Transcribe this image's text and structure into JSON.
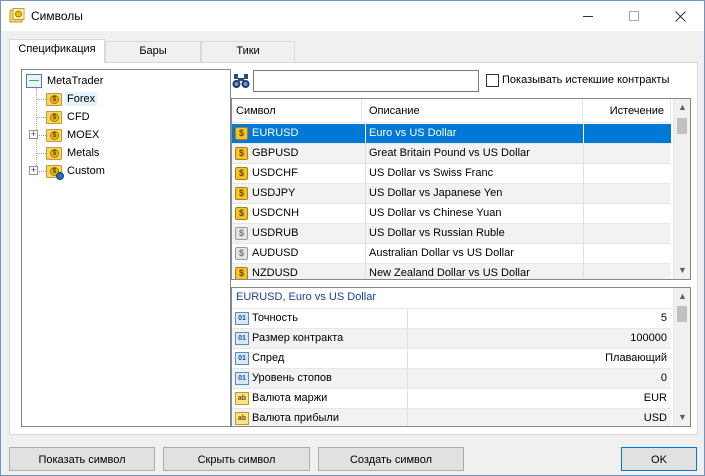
{
  "window": {
    "title": "Символы",
    "colors": {
      "accent": "#0078d7",
      "selected_tree": "#e5f3ff",
      "props_title": "#1a3fa0"
    }
  },
  "tabs": [
    {
      "label": "Спецификация",
      "active": true
    },
    {
      "label": "Бары",
      "active": false
    },
    {
      "label": "Тики",
      "active": false
    }
  ],
  "tree": {
    "root": "MetaTrader",
    "items": [
      {
        "label": "Forex",
        "selected": true,
        "expandable": false,
        "icon": "currency-folder-icon"
      },
      {
        "label": "CFD",
        "selected": false,
        "expandable": false,
        "icon": "currency-folder-icon"
      },
      {
        "label": "MOEX",
        "selected": false,
        "expandable": true,
        "icon": "currency-folder-icon"
      },
      {
        "label": "Metals",
        "selected": false,
        "expandable": false,
        "icon": "currency-folder-icon"
      },
      {
        "label": "Custom",
        "selected": false,
        "expandable": true,
        "icon": "custom-folder-icon"
      }
    ]
  },
  "search": {
    "value": "",
    "show_expired_label": "Показывать истекшие контракты",
    "show_expired_checked": false
  },
  "symbols": {
    "columns": [
      "Символ",
      "Описание",
      "Истечение"
    ],
    "rows": [
      {
        "symbol": "EURUSD",
        "description": "Euro vs US Dollar",
        "expiry": "",
        "enabled": true,
        "selected": true
      },
      {
        "symbol": "GBPUSD",
        "description": "Great Britain Pound vs US Dollar",
        "expiry": "",
        "enabled": true,
        "selected": false
      },
      {
        "symbol": "USDCHF",
        "description": "US Dollar vs Swiss Franc",
        "expiry": "",
        "enabled": true,
        "selected": false
      },
      {
        "symbol": "USDJPY",
        "description": "US Dollar vs Japanese Yen",
        "expiry": "",
        "enabled": true,
        "selected": false
      },
      {
        "symbol": "USDCNH",
        "description": "US Dollar vs Chinese Yuan",
        "expiry": "",
        "enabled": true,
        "selected": false
      },
      {
        "symbol": "USDRUB",
        "description": "US Dollar vs Russian Ruble",
        "expiry": "",
        "enabled": false,
        "selected": false
      },
      {
        "symbol": "AUDUSD",
        "description": "Australian Dollar vs US Dollar",
        "expiry": "",
        "enabled": false,
        "selected": false
      },
      {
        "symbol": "NZDUSD",
        "description": "New Zealand Dollar vs US Dollar",
        "expiry": "",
        "enabled": true,
        "selected": false
      }
    ]
  },
  "properties": {
    "title": "EURUSD, Euro vs US Dollar",
    "rows": [
      {
        "name": "Точность",
        "value": "5",
        "icon": "01"
      },
      {
        "name": "Размер контракта",
        "value": "100000",
        "icon": "01"
      },
      {
        "name": "Спред",
        "value": "Плавающий",
        "icon": "01"
      },
      {
        "name": "Уровень стопов",
        "value": "0",
        "icon": "01"
      },
      {
        "name": "Валюта маржи",
        "value": "EUR",
        "icon": "ab"
      },
      {
        "name": "Валюта прибыли",
        "value": "USD",
        "icon": "ab"
      }
    ]
  },
  "buttons": {
    "show": "Показать символ",
    "hide": "Скрыть символ",
    "create": "Создать символ",
    "ok": "OK"
  }
}
